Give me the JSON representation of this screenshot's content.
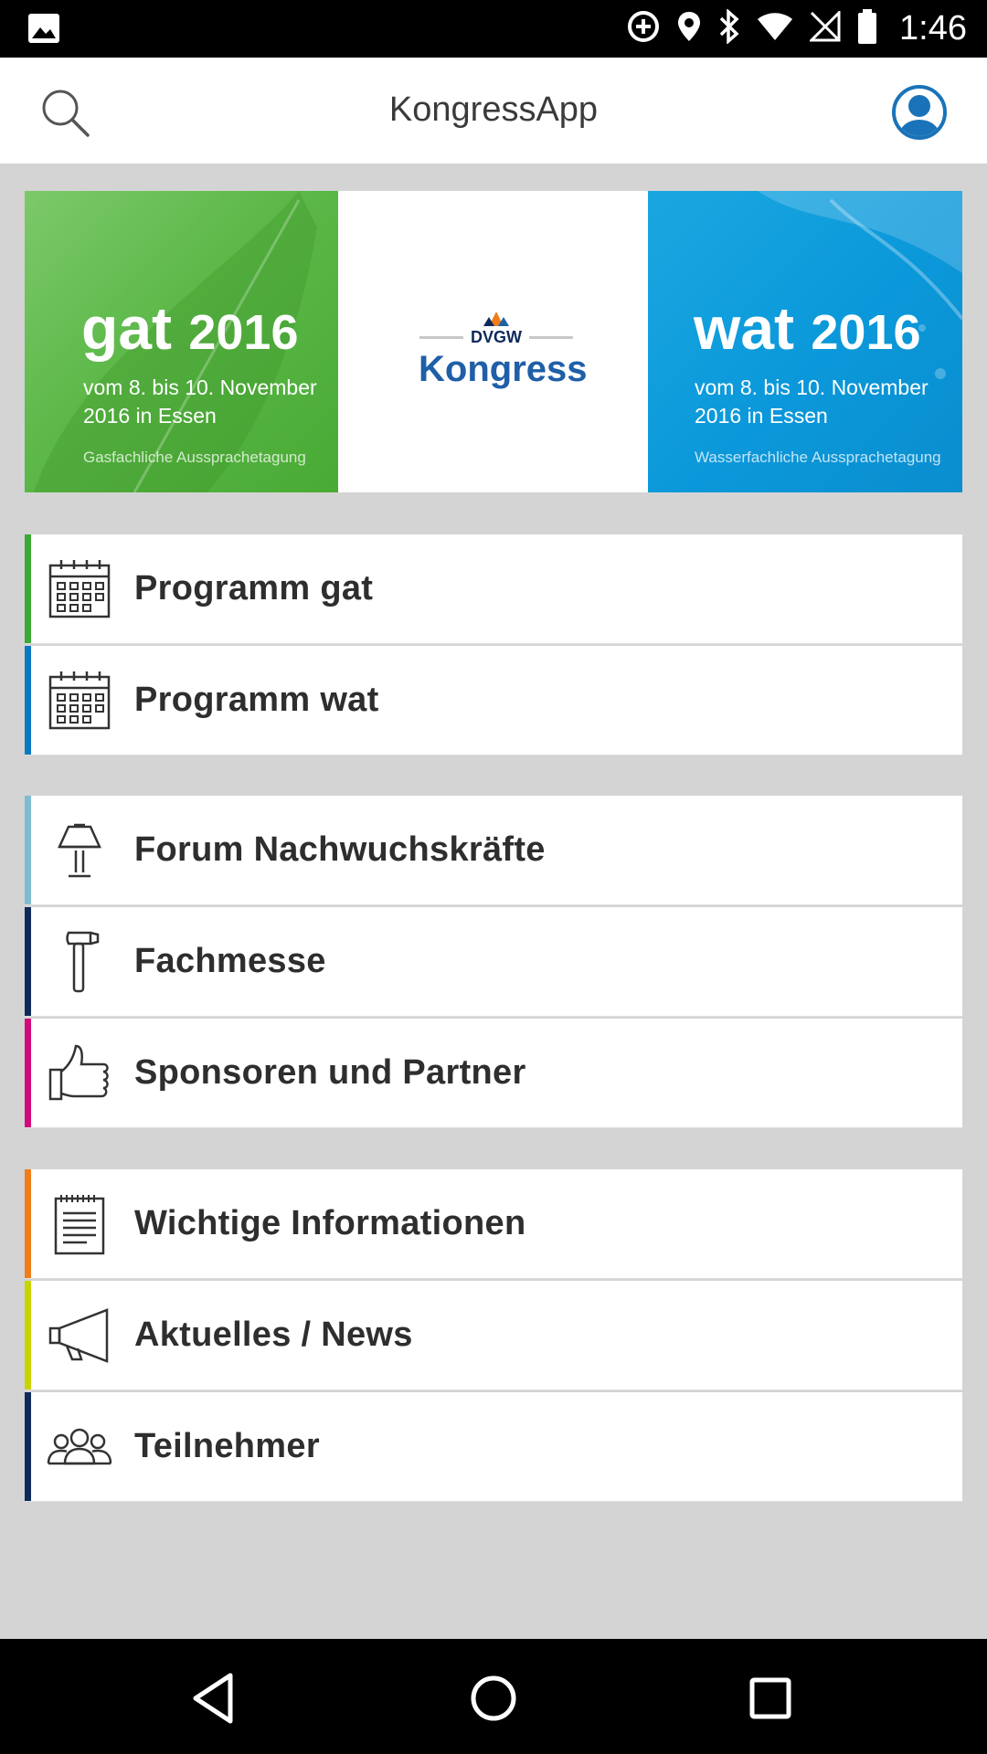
{
  "status_bar": {
    "time": "1:46"
  },
  "app_bar": {
    "title": "KongressApp"
  },
  "banner": {
    "gat": {
      "name": "gat",
      "year": "2016",
      "date": "vom 8. bis 10. November 2016 in Essen",
      "subtitle": "Gasfachliche Aussprachetagung",
      "color": "#5cb848"
    },
    "center": {
      "org": "DVGW",
      "name": "Kongress"
    },
    "wat": {
      "name": "wat",
      "year": "2016",
      "date": "vom 8. bis 10. November 2016 in Essen",
      "subtitle": "Wasserfachliche Aussprachetagung",
      "color": "#0b98da"
    }
  },
  "menu": {
    "group1": [
      {
        "label": "Programm gat",
        "icon": "calendar-icon",
        "accent": "#3aaa35"
      },
      {
        "label": "Programm wat",
        "icon": "calendar-icon",
        "accent": "#0b79c1"
      }
    ],
    "group2": [
      {
        "label": "Forum Nachwuchskräfte",
        "icon": "lectern-icon",
        "accent": "#7fbcd2"
      },
      {
        "label": "Fachmesse",
        "icon": "hammer-icon",
        "accent": "#0d2a5a"
      },
      {
        "label": "Sponsoren und Partner",
        "icon": "thumbs-up-icon",
        "accent": "#d1097c"
      }
    ],
    "group3": [
      {
        "label": "Wichtige Informationen",
        "icon": "notepad-icon",
        "accent": "#ef7d1a"
      },
      {
        "label": "Aktuelles / News",
        "icon": "megaphone-icon",
        "accent": "#c8d400"
      },
      {
        "label": "Teilnehmer",
        "icon": "people-icon",
        "accent": "#0d2a5a"
      }
    ]
  }
}
